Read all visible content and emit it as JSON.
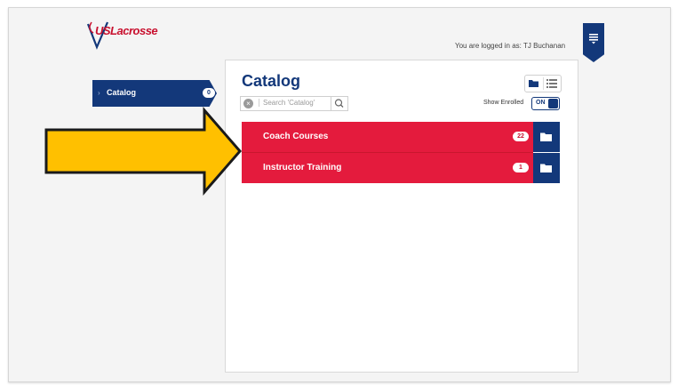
{
  "header": {
    "logo_text": "USLacrosse",
    "logged_in_text": "You are logged in as: TJ Buchanan"
  },
  "sidebar": {
    "items": [
      {
        "label": "Catalog",
        "count": "0"
      }
    ]
  },
  "catalog": {
    "title": "Catalog",
    "search_placeholder": "Search 'Catalog'",
    "show_enrolled_label": "Show Enrolled",
    "toggle_state": "ON",
    "rows": [
      {
        "label": "Coach Courses",
        "count": "22"
      },
      {
        "label": "Instructor Training",
        "count": "1"
      }
    ]
  },
  "colors": {
    "navy": "#13387a",
    "red": "#e41b3d",
    "arrow": "#ffc000"
  },
  "icons": [
    "menu-icon",
    "chevron-right-icon",
    "clear-icon",
    "search-icon",
    "folder-icon",
    "list-icon",
    "arrow-icon"
  ]
}
